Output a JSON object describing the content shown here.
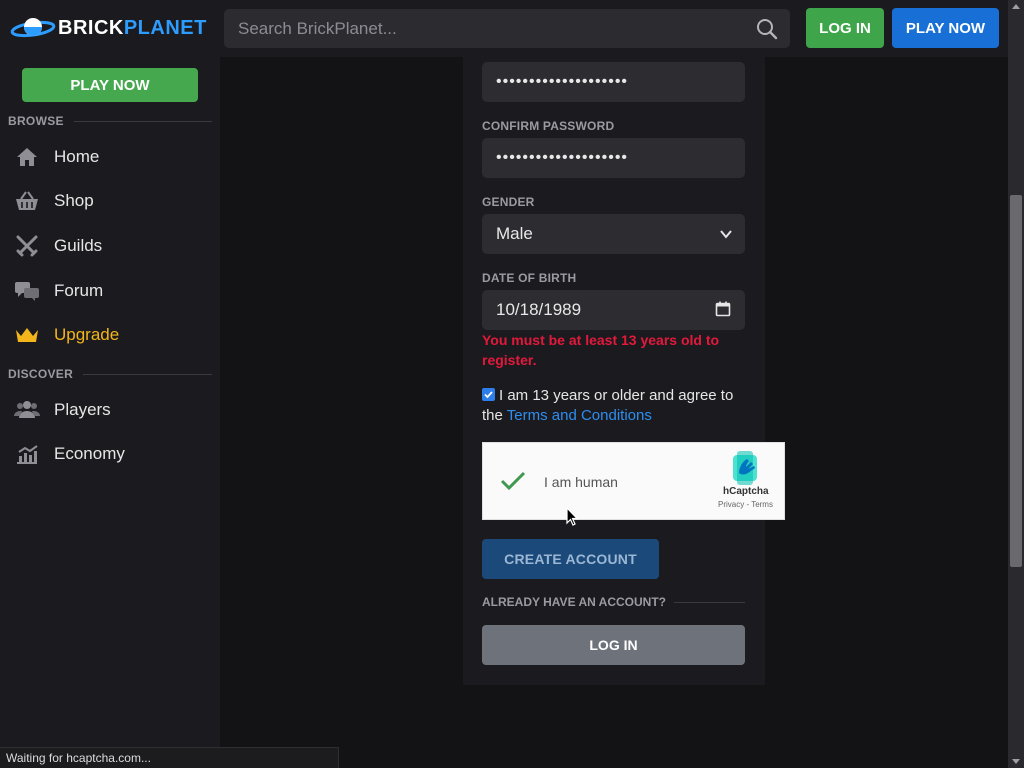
{
  "header": {
    "logo": {
      "brick": "BRICK",
      "planet": "PLANET"
    },
    "search_placeholder": "Search BrickPlanet...",
    "login_label": "LOG IN",
    "play_label": "PLAY NOW"
  },
  "sidebar": {
    "play_label": "PLAY NOW",
    "browse_heading": "BROWSE",
    "discover_heading": "DISCOVER",
    "browse_items": [
      {
        "label": "Home",
        "icon": "home-icon"
      },
      {
        "label": "Shop",
        "icon": "basket-icon"
      },
      {
        "label": "Guilds",
        "icon": "crossed-swords-icon"
      },
      {
        "label": "Forum",
        "icon": "chat-bubbles-icon"
      },
      {
        "label": "Upgrade",
        "icon": "crown-icon"
      }
    ],
    "discover_items": [
      {
        "label": "Players",
        "icon": "users-icon"
      },
      {
        "label": "Economy",
        "icon": "chart-icon"
      }
    ]
  },
  "form": {
    "password_value": "••••••••••••••••••••",
    "confirm_label": "CONFIRM PASSWORD",
    "confirm_value": "••••••••••••••••••••",
    "gender_label": "GENDER",
    "gender_value": "Male",
    "dob_label": "DATE OF BIRTH",
    "dob_value": "10/18/1989",
    "error_text": "You must be at least 13 years old to register.",
    "agree_text": "I am 13 years or older and agree to the",
    "terms_link": "Terms and Conditions",
    "agree_checked": true,
    "captcha": {
      "label": "I am human",
      "brand": "hCaptcha",
      "links": "Privacy - Terms",
      "checked": true
    },
    "create_label": "CREATE ACCOUNT",
    "already_label": "ALREADY HAVE AN ACCOUNT?",
    "login_label": "LOG IN"
  },
  "status_bar": "Waiting for hcaptcha.com...",
  "colors": {
    "background": "#131316",
    "panel": "#1b1b1f",
    "green": "#3fa54a",
    "blue": "#1870d6",
    "error": "#e3193c",
    "upgrade": "#f3b51a"
  }
}
